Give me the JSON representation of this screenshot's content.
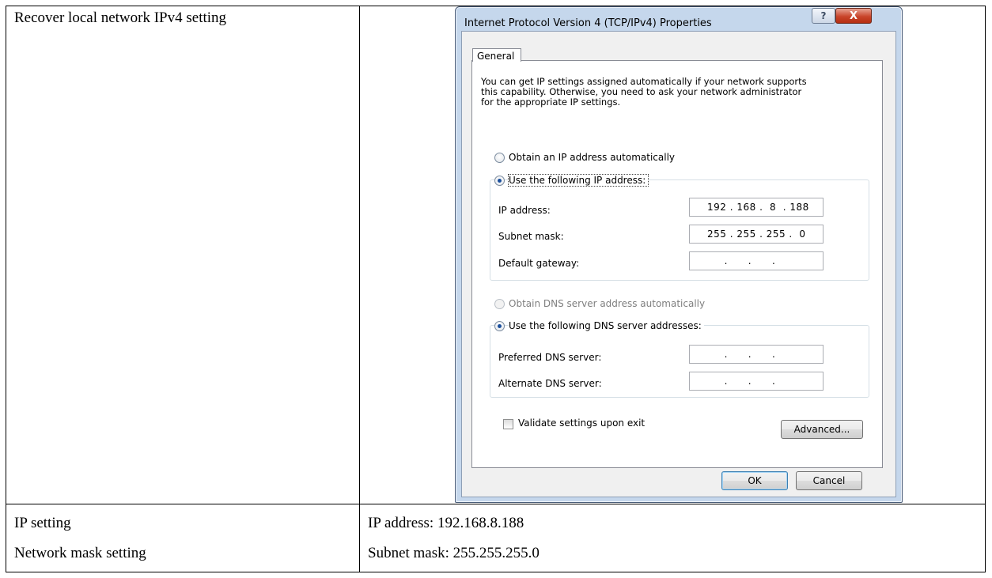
{
  "table": {
    "row1_label": "Recover local network IPv4 setting",
    "row2_label": "IP setting",
    "row2_value": "IP address: 192.168.8.188",
    "row3_label": "Network mask setting",
    "row3_value": "Subnet mask: 255.255.255.0"
  },
  "dialog": {
    "title": "Internet Protocol Version 4 (TCP/IPv4) Properties",
    "help_label": "?",
    "close_label": "X",
    "tab_general": "General",
    "description": [
      "You can get IP settings assigned automatically if your network supports",
      "this capability. Otherwise, you need to ask your network administrator",
      "for the appropriate IP settings."
    ],
    "ip_auto_label": "Obtain an IP address automatically",
    "ip_manual_label": "Use the following IP address:",
    "ip_address_label": "IP address:",
    "ip_address_value": "192 . 168 .  8  . 188",
    "subnet_label": "Subnet mask:",
    "subnet_value": "255 . 255 . 255 .  0",
    "gateway_label": "Default gateway:",
    "gateway_value": "     .      .      .",
    "dns_auto_label": "Obtain DNS server address automatically",
    "dns_manual_label": "Use the following DNS server addresses:",
    "preferred_dns_label": "Preferred DNS server:",
    "preferred_dns_value": "     .      .      .",
    "alternate_dns_label": "Alternate DNS server:",
    "alternate_dns_value": "     .      .      .",
    "validate_label": "Validate settings upon exit",
    "advanced_label": "Advanced...",
    "ok_label": "OK",
    "cancel_label": "Cancel",
    "ip_auto_selected": false,
    "ip_manual_selected": true,
    "dns_auto_enabled": false,
    "dns_manual_selected": true,
    "validate_checked": false
  },
  "colors": {
    "title_bar": "#c5d7ec",
    "close_button": "#c9452b",
    "default_button_border": "#3c7fb1",
    "radio_dot": "#1a4f9c"
  }
}
